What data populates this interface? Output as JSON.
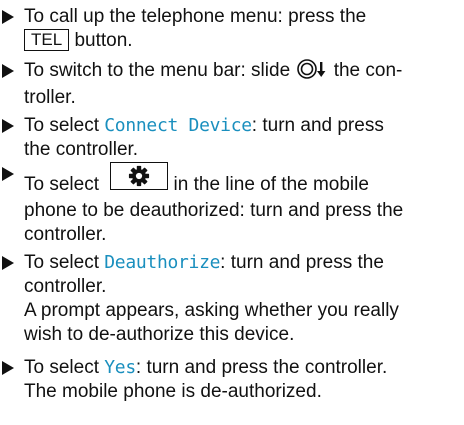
{
  "steps": [
    {
      "pre": "To call up the telephone menu: press the",
      "key": "TEL",
      "post": "button."
    },
    {
      "pre": "To switch to the menu bar: slide",
      "post": "the con-",
      "line2": "troller."
    },
    {
      "pre": "To select",
      "kw": "Connect Device",
      "post": ": turn and press",
      "line2": "the controller."
    },
    {
      "pre": "To select",
      "line2": "in the line of the mobile",
      "line3": "phone to be deauthorized: turn and press the",
      "line4": "controller."
    },
    {
      "pre": "To select",
      "kw": "Deauthorize",
      "post": ": turn and press the",
      "line2": "controller.",
      "line3": "A prompt appears, asking whether you really",
      "line4": "wish to de-authorize this device."
    },
    {
      "pre": "To select",
      "kw": "Yes",
      "post": ": turn and press the controller.",
      "line2": "The mobile phone is de-authorized."
    }
  ],
  "icons": {
    "bullet": "right-triangle-bullet",
    "controller": "controller-slide-down-icon",
    "settings": "gear-icon"
  },
  "colors": {
    "keyword": "#1a8fbe",
    "text": "#111111"
  }
}
